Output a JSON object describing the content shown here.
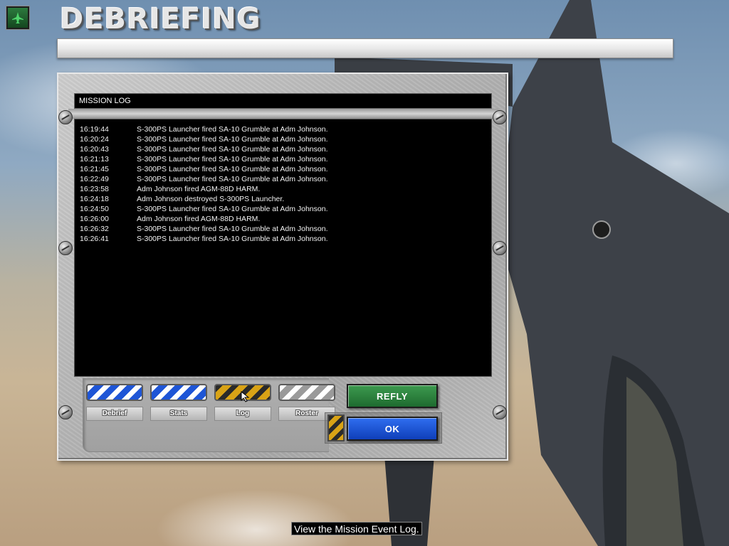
{
  "screen": {
    "title": "DEBRIEFING"
  },
  "log": {
    "header": "MISSION LOG",
    "entries": [
      {
        "time": "16:19:44",
        "message": "S-300PS Launcher fired SA-10 Grumble at Adm Johnson."
      },
      {
        "time": "16:20:24",
        "message": "S-300PS Launcher fired SA-10 Grumble at Adm Johnson."
      },
      {
        "time": "16:20:43",
        "message": "S-300PS Launcher fired SA-10 Grumble at Adm Johnson."
      },
      {
        "time": "16:21:13",
        "message": "S-300PS Launcher fired SA-10 Grumble at Adm Johnson."
      },
      {
        "time": "16:21:45",
        "message": "S-300PS Launcher fired SA-10 Grumble at Adm Johnson."
      },
      {
        "time": "16:22:49",
        "message": "S-300PS Launcher fired SA-10 Grumble at Adm Johnson."
      },
      {
        "time": "16:23:58",
        "message": "Adm Johnson fired AGM-88D HARM."
      },
      {
        "time": "16:24:18",
        "message": "Adm Johnson destroyed S-300PS Launcher."
      },
      {
        "time": "16:24:50",
        "message": "S-300PS Launcher fired SA-10 Grumble at Adm Johnson."
      },
      {
        "time": "16:26:00",
        "message": "Adm Johnson fired AGM-88D HARM."
      },
      {
        "time": "16:26:32",
        "message": "S-300PS Launcher fired SA-10 Grumble at Adm Johnson."
      },
      {
        "time": "16:26:41",
        "message": "S-300PS Launcher fired SA-10 Grumble at Adm Johnson."
      }
    ]
  },
  "tabs": [
    {
      "label": "Debrief",
      "style": "blue"
    },
    {
      "label": "Stats",
      "style": "blue"
    },
    {
      "label": "Log",
      "style": "yellow",
      "active": true
    },
    {
      "label": "Roster",
      "style": "grey"
    }
  ],
  "buttons": {
    "refly": "REFLY",
    "ok": "OK"
  },
  "status_tip": "View the Mission Event Log.",
  "colors": {
    "refly_green": "#2a8040",
    "ok_blue": "#1f55dd",
    "active_tab_yellow": "#d9a316",
    "tab_blue": "#1e55d6"
  },
  "icons": {
    "home": "jet-plane-icon",
    "cursor": "arrow-cursor-icon"
  }
}
